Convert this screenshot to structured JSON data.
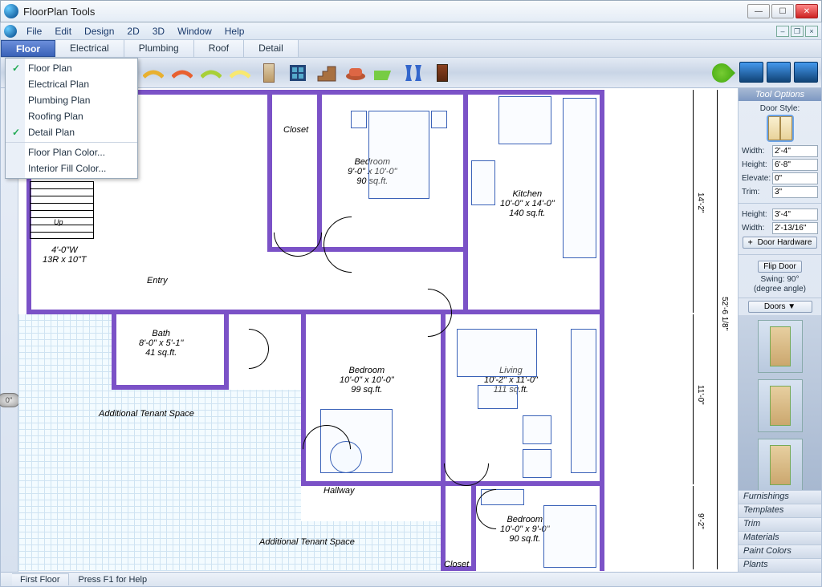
{
  "window": {
    "title": "FloorPlan Tools"
  },
  "menus": {
    "items": [
      "File",
      "Edit",
      "Design",
      "2D",
      "3D",
      "Window",
      "Help"
    ]
  },
  "tabs": {
    "items": [
      "Floor",
      "Electrical",
      "Plumbing",
      "Roof",
      "Detail"
    ],
    "active": 0
  },
  "dropdown": {
    "items": [
      {
        "label": "Floor Plan",
        "checked": true
      },
      {
        "label": "Electrical Plan",
        "checked": false
      },
      {
        "label": "Plumbing Plan",
        "checked": false
      },
      {
        "label": "Roofing Plan",
        "checked": false
      },
      {
        "label": "Detail Plan",
        "checked": true
      }
    ],
    "extra": [
      {
        "label": "Floor Plan Color..."
      },
      {
        "label": "Interior Fill Color..."
      }
    ]
  },
  "status": {
    "tab": "First Floor",
    "message": "Press F1 for Help"
  },
  "knob": {
    "value": "0\""
  },
  "tool_options": {
    "header": "Tool Options",
    "style_label": "Door Style:",
    "props1": [
      {
        "k": "Width:",
        "v": "2'-4\""
      },
      {
        "k": "Height:",
        "v": "6'-8\""
      },
      {
        "k": "Elevate:",
        "v": "0\""
      },
      {
        "k": "Trim:",
        "v": "3\""
      }
    ],
    "props2": [
      {
        "k": "Height:",
        "v": "3'-4\""
      },
      {
        "k": "Width:",
        "v": "2'-13/16\""
      }
    ],
    "door_hardware_btn": "Door Hardware",
    "flip_btn": "Flip Door",
    "swing_label": "Swing:",
    "swing_value": "90°",
    "swing_note": "(degree angle)",
    "doors_dd": "Doors ▼",
    "categories": [
      "Furnishings",
      "Templates",
      "Trim",
      "Materials",
      "Paint Colors",
      "Plants"
    ]
  },
  "rooms": {
    "entry": "Entry",
    "bath": "Bath\n8'-0\" x 5'-1\"\n41 sq.ft.",
    "closet1": "Closet",
    "bedroom1": "Bedroom\n9'-0\" x 10'-0\"\n90 sq.ft.",
    "kitchen": "Kitchen\n10'-0\" x 14'-0\"\n140 sq.ft.",
    "bedroom2": "Bedroom\n10'-0\" x 10'-0\"\n99 sq.ft.",
    "living": "Living\n10'-2\" x 11'-0\"\n111 sq.ft.",
    "hallway": "Hallway",
    "bedroom3": "Bedroom\n10'-0\" x 9'-0\"\n90 sq.ft.",
    "closet2": "Closet",
    "addl1": "Additional Tenant Space",
    "addl2": "Additional Tenant Space",
    "stairs": "Up",
    "stairs_dim": "4'-0\"W\n13R x 10\"T"
  },
  "dims": {
    "overall_h": "52'-6 1/8\"",
    "top_right": "14'-2\"",
    "mid_right": "11'-0\"",
    "bot_right": "9'-2\""
  }
}
